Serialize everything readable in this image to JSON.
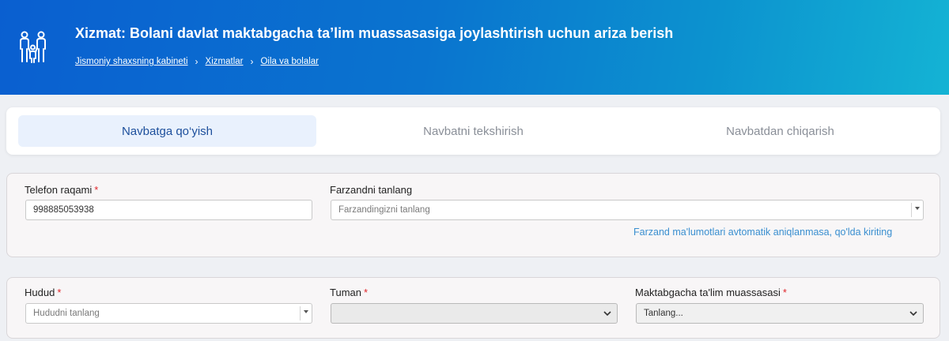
{
  "header": {
    "icon": "family-icon",
    "title": "Xizmat: Bolani davlat maktabgacha ta’lim muassasasiga joylashtirish uchun ariza berish",
    "breadcrumbs": [
      "Jismoniy shaxsning kabineti",
      "Xizmatlar",
      "Oila va bolalar"
    ],
    "gradient": [
      "#0a5fd0",
      "#14b3d4"
    ]
  },
  "tabs": [
    {
      "label": "Navbatga qo‘yish",
      "active": true
    },
    {
      "label": "Navbatni tekshirish",
      "active": false
    },
    {
      "label": "Navbatdan chiqarish",
      "active": false
    }
  ],
  "form1": {
    "phone_label": "Telefon raqami",
    "phone_value": "998885053938",
    "child_label": "Farzandni tanlang",
    "child_placeholder": "Farzandingizni tanlang",
    "manual_link": "Farzand ma'lumotlari avtomatik aniqlanmasa, qo'lda kiriting"
  },
  "form2": {
    "region_label": "Hudud",
    "region_placeholder": "Hududni tanlang",
    "district_label": "Tuman",
    "district_value": "",
    "school_label": "Maktabgacha ta'lim muassasasi",
    "school_value": "Tanlang..."
  },
  "required_mark": "*",
  "colors": {
    "accent": "#1d4f9c",
    "link": "#3a8fd0",
    "required": "#e0262b"
  }
}
